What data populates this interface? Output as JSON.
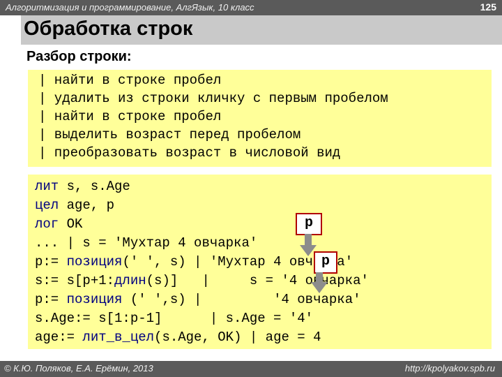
{
  "header": {
    "course": "Алгоритмизация и программирование, АлгЯзык, 10 класс",
    "page_number": "125"
  },
  "slide": {
    "title": "Обработка строк",
    "subtitle": "Разбор строки:"
  },
  "comments": [
    "| найти в строке пробел",
    "| удалить из строки кличку с первым пробелом",
    "| найти в строке пробел",
    "| выделить возраст перед пробелом",
    "| преобразовать возраст в числовой вид"
  ],
  "code": {
    "l1": {
      "kw": "лит",
      "rest": " s, s.Age"
    },
    "l2": {
      "kw": "цел",
      "rest": " age, p"
    },
    "l3": {
      "kw": "лог",
      "rest": " OK"
    },
    "l4": {
      "text": "... | s = 'Мухтар 4 овчарка'"
    },
    "l5": {
      "a": "p:= ",
      "fn": "позиция",
      "b": "(' ', s) | 'Мухтар 4 овчарка'"
    },
    "l6": {
      "a": "s:= s[p+1:",
      "fn": "длин",
      "b": "(s)]   |     s = '4 овчарка'"
    },
    "l7": {
      "a": "p:= ",
      "fn": "позиция",
      "b": " (' ',s) |         '4 овчарка'"
    },
    "l8": {
      "text": "s.Age:= s[1:p-1]      | s.Age = '4'"
    },
    "l9": {
      "a": "age:= ",
      "fn": "лит_в_цел",
      "b": "(s.Age, OK) | age = 4"
    }
  },
  "markers": {
    "p_label": "p"
  },
  "footer": {
    "authors": "© К.Ю. Поляков, Е.А. Ерёмин, 2013",
    "url": "http://kpolyakov.spb.ru"
  }
}
